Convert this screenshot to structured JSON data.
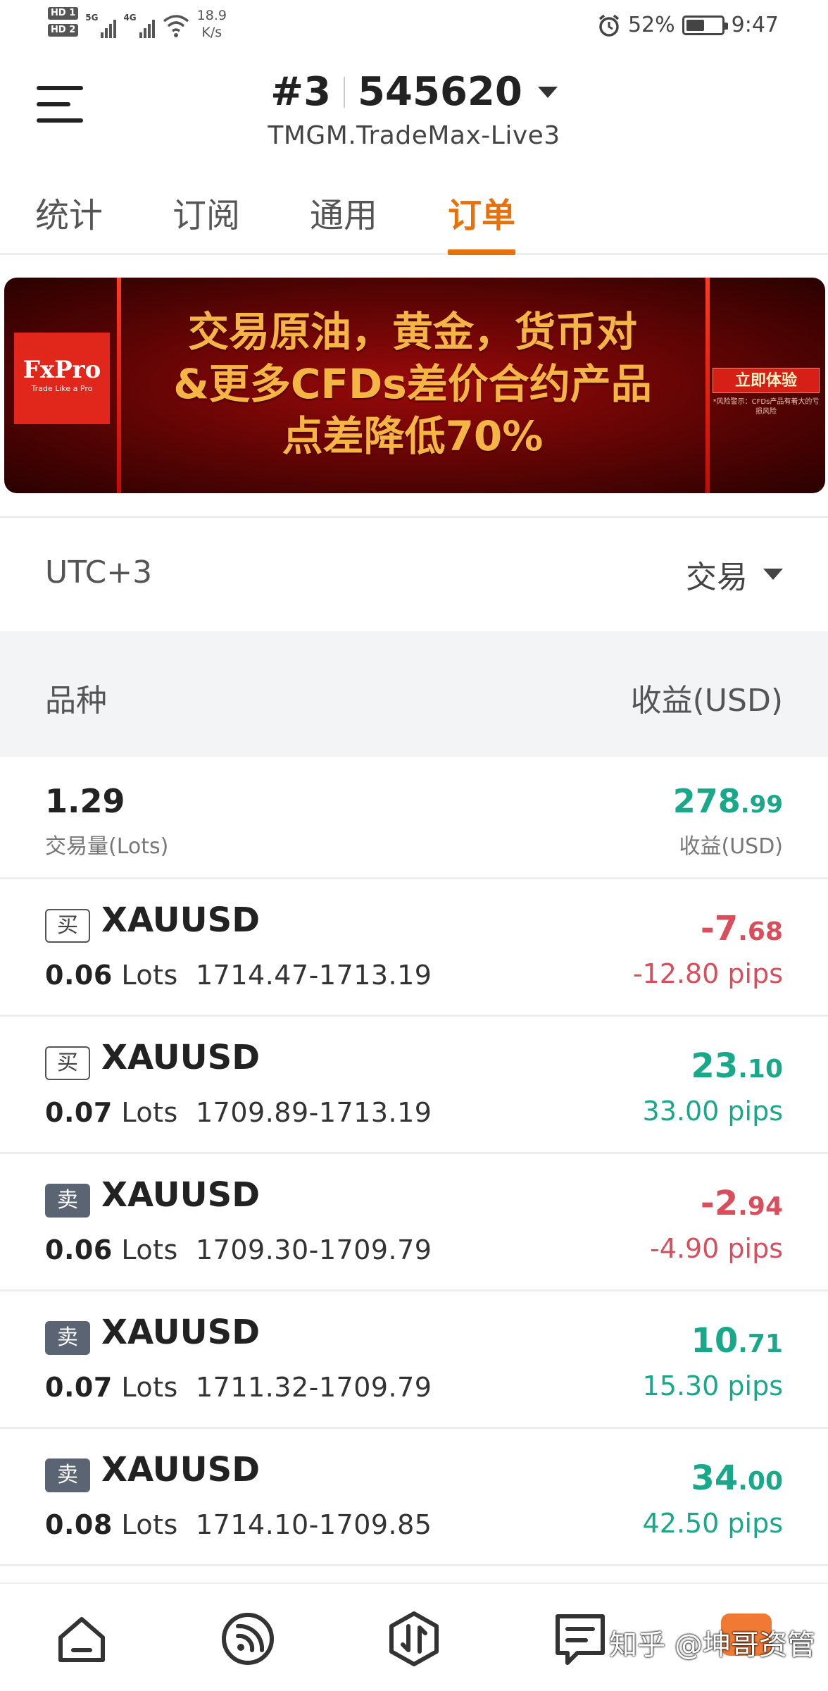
{
  "status_bar": {
    "hd1": "HD 1",
    "hd2": "HD 2",
    "net1": "5G",
    "net2": "4G",
    "speed_value": "18.9",
    "speed_unit": "K/s",
    "battery": "52%",
    "battery_level": 0.52,
    "time": "9:47"
  },
  "header": {
    "account_prefix": "#3",
    "account_number": "545620",
    "server": "TMGM.TradeMax-Live3"
  },
  "tabs": [
    {
      "label": "统计"
    },
    {
      "label": "订阅"
    },
    {
      "label": "通用"
    },
    {
      "label": "订单",
      "active": true
    }
  ],
  "banner": {
    "logo": "FxPro",
    "logo_tagline": "Trade Like a Pro",
    "line1": "交易原油，黄金，货币对",
    "line2": "&更多CFDs差价合约产品",
    "line3": "点差降低70%",
    "cta": "立即体验",
    "cta_note": "*风险警示：CFDs产品有着大的亏损风险"
  },
  "filter": {
    "timezone": "UTC+3",
    "type": "交易"
  },
  "table_header": {
    "symbol_col": "品种",
    "profit_col": "收益(USD)"
  },
  "summary": {
    "lots": "1.29",
    "lots_label": "交易量(Lots)",
    "profit_int": "278",
    "profit_dec": ".99",
    "profit_label": "收益(USD)"
  },
  "orders": [
    {
      "side": "买",
      "side_type": "buy",
      "symbol": "XAUUSD",
      "lots": "0.06",
      "lots_unit": "Lots",
      "prices": "1714.47-1713.19",
      "pnl_int": "-7",
      "pnl_dec": ".68",
      "pips": "-12.80 pips",
      "sign": "neg"
    },
    {
      "side": "买",
      "side_type": "buy",
      "symbol": "XAUUSD",
      "lots": "0.07",
      "lots_unit": "Lots",
      "prices": "1709.89-1713.19",
      "pnl_int": "23",
      "pnl_dec": ".10",
      "pips": "33.00 pips",
      "sign": "pos"
    },
    {
      "side": "卖",
      "side_type": "sell",
      "symbol": "XAUUSD",
      "lots": "0.06",
      "lots_unit": "Lots",
      "prices": "1709.30-1709.79",
      "pnl_int": "-2",
      "pnl_dec": ".94",
      "pips": "-4.90 pips",
      "sign": "neg"
    },
    {
      "side": "卖",
      "side_type": "sell",
      "symbol": "XAUUSD",
      "lots": "0.07",
      "lots_unit": "Lots",
      "prices": "1711.32-1709.79",
      "pnl_int": "10",
      "pnl_dec": ".71",
      "pips": "15.30 pips",
      "sign": "pos"
    },
    {
      "side": "卖",
      "side_type": "sell",
      "symbol": "XAUUSD",
      "lots": "0.08",
      "lots_unit": "Lots",
      "prices": "1714.10-1709.85",
      "pnl_int": "34",
      "pnl_dec": ".00",
      "pips": "42.50 pips",
      "sign": "pos"
    }
  ],
  "bottom_nav": [
    {
      "icon": "home-icon"
    },
    {
      "icon": "signal-feed-icon"
    },
    {
      "icon": "trade-icon"
    },
    {
      "icon": "orders-list-icon"
    }
  ],
  "watermark": "知乎 @坤哥资管",
  "colors": {
    "accent": "#e8710a",
    "profit": "#1aa88a",
    "loss": "#d84e5c"
  }
}
